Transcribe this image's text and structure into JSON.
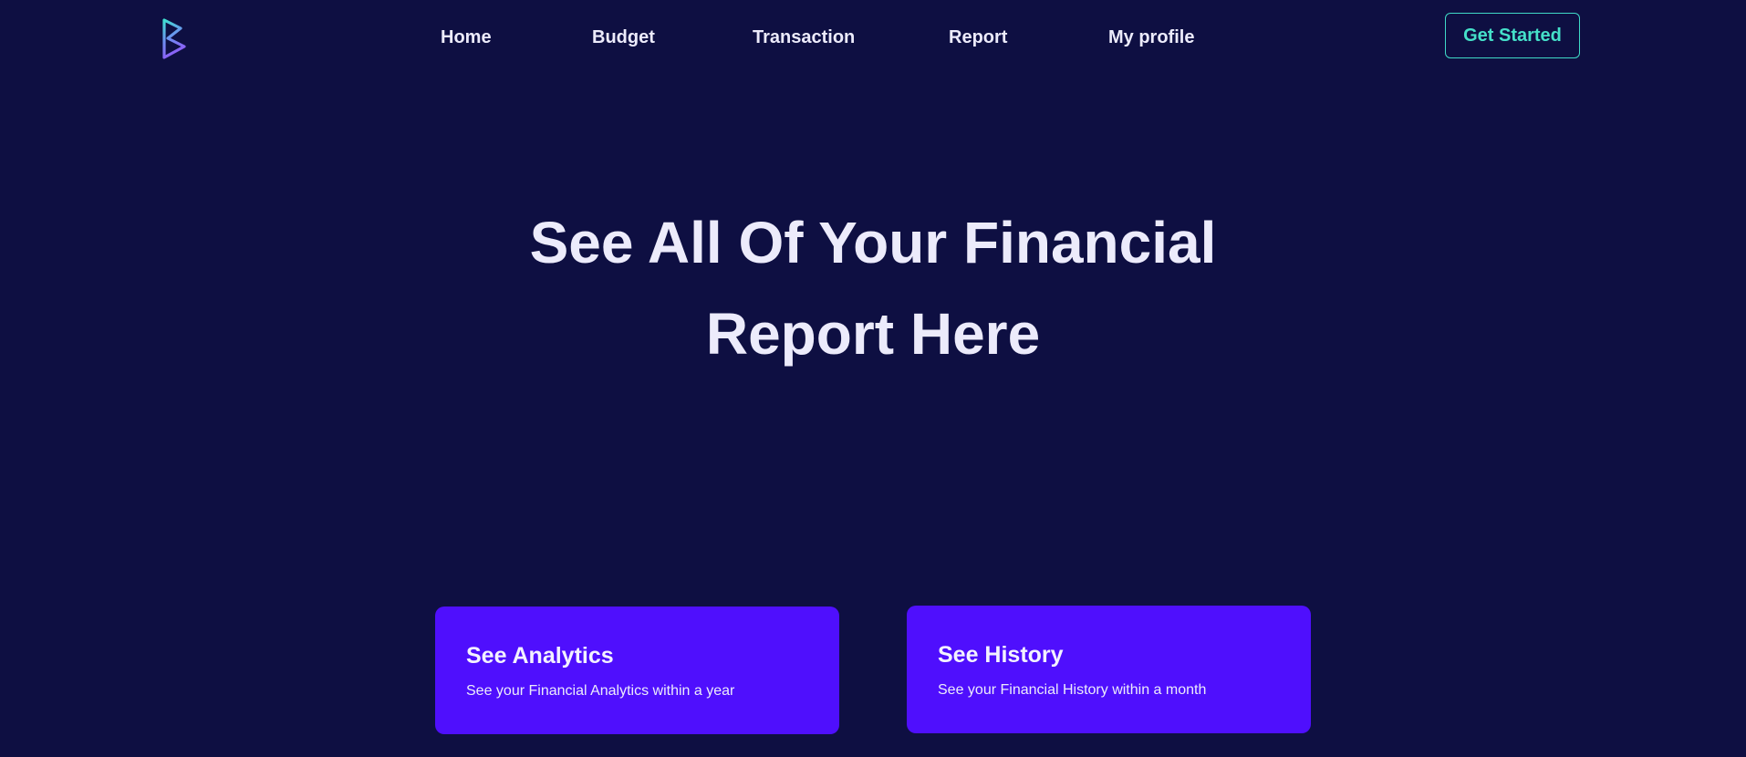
{
  "nav": {
    "logo": "B-logo",
    "links": [
      {
        "label": "Home"
      },
      {
        "label": "Budget"
      },
      {
        "label": "Transaction"
      },
      {
        "label": "Report"
      },
      {
        "label": "My profile"
      }
    ],
    "cta_label": "Get Started"
  },
  "hero": {
    "title_line1": "See All Of Your Financial",
    "title_line2": "Report Here"
  },
  "cards": [
    {
      "title": "See Analytics",
      "description": "See your Financial Analytics within a year"
    },
    {
      "title": "See History",
      "description": "See your Financial History within a month"
    }
  ],
  "colors": {
    "background": "#0e0f42",
    "card": "#4f0ffd",
    "accent": "#45e0c9",
    "text": "#ecebfb"
  }
}
